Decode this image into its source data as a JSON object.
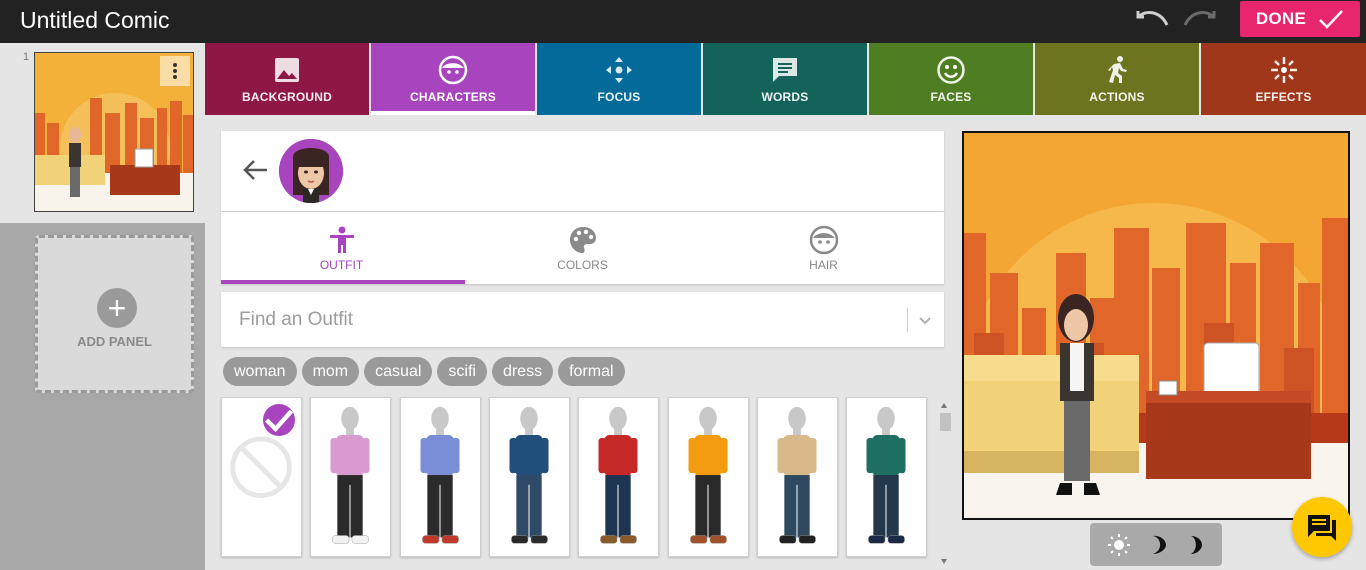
{
  "app": {
    "title": "Untitled Comic",
    "done_label": "DONE"
  },
  "panels": {
    "items": [
      {
        "number": "1"
      }
    ],
    "add_label": "ADD PANEL"
  },
  "tabs": [
    {
      "label": "BACKGROUND",
      "icon": "image-icon",
      "color": "#8f1746"
    },
    {
      "label": "CHARACTERS",
      "icon": "face-icon",
      "color": "#a744be",
      "active": true
    },
    {
      "label": "FOCUS",
      "icon": "focus-icon",
      "color": "#036a99"
    },
    {
      "label": "WORDS",
      "icon": "speech-bubble-icon",
      "color": "#13635a"
    },
    {
      "label": "FACES",
      "icon": "smiley-icon",
      "color": "#4f7d21"
    },
    {
      "label": "ACTIONS",
      "icon": "running-icon",
      "color": "#6c741f"
    },
    {
      "label": "EFFECTS",
      "icon": "sparkle-icon",
      "color": "#a0371a"
    }
  ],
  "character_editor": {
    "subtabs": [
      {
        "label": "OUTFIT",
        "icon": "person-icon",
        "active": true
      },
      {
        "label": "COLORS",
        "icon": "palette-icon"
      },
      {
        "label": "HAIR",
        "icon": "face-icon"
      }
    ],
    "search": {
      "placeholder": "Find an Outfit",
      "value": ""
    },
    "tags": [
      "woman",
      "mom",
      "casual",
      "scifi",
      "dress",
      "formal"
    ],
    "outfits": [
      {
        "name": "none",
        "selected": true
      },
      {
        "name": "pink hoodie",
        "top": "#d99ad0",
        "bottom": "#2a2a2a",
        "shoe": "#f2f2f2"
      },
      {
        "name": "blue tee",
        "top": "#7a8ed8",
        "bottom": "#2b2b2b",
        "shoe": "#c0392b"
      },
      {
        "name": "navy tee jeans",
        "top": "#1f4f7a",
        "bottom": "#2f4a66",
        "shoe": "#2a2a2a"
      },
      {
        "name": "plaid shirt",
        "top": "#c62828",
        "bottom": "#1e3552",
        "shoe": "#8b5a2b"
      },
      {
        "name": "striped scarf",
        "top": "#f39c12",
        "bottom": "#2a2a2a",
        "shoe": "#a0522d"
      },
      {
        "name": "beige sweater",
        "top": "#d9b98a",
        "bottom": "#2f4a60",
        "shoe": "#222"
      },
      {
        "name": "teal dress",
        "top": "#1f6f63",
        "bottom": "#23384a",
        "shoe": "#1a2a44"
      }
    ]
  },
  "preview": {
    "lighting": [
      "sun-icon",
      "moon-icon",
      "moon-dark-icon"
    ]
  }
}
